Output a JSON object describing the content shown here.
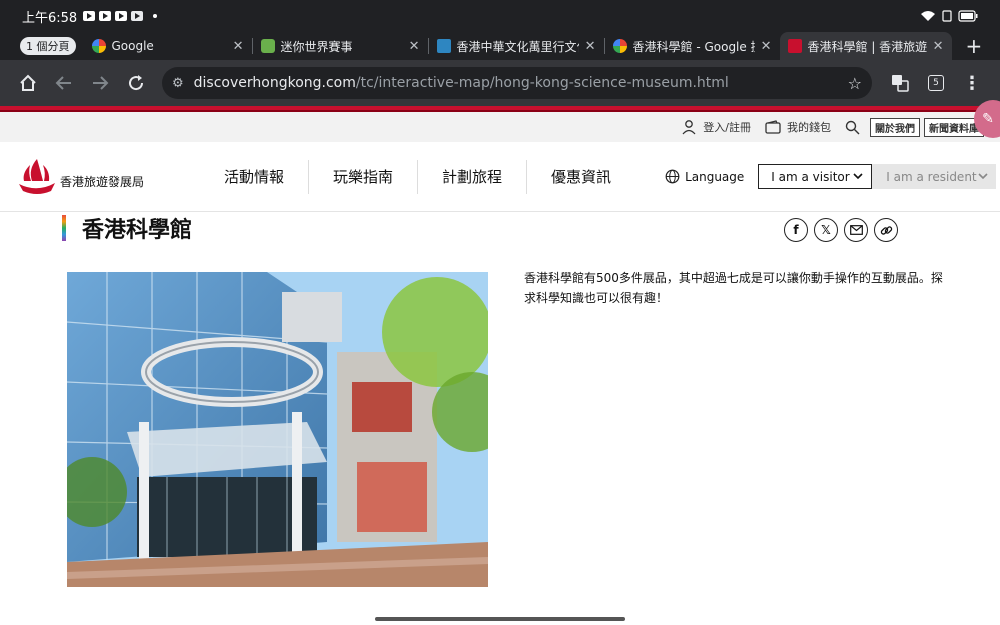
{
  "status_bar": {
    "time": "上午6:58"
  },
  "browser": {
    "tab_group_label": "1 個分頁",
    "tabs": [
      {
        "title": "Google"
      },
      {
        "title": "迷你世界賽事"
      },
      {
        "title": "香港中華文化萬里行文化影"
      },
      {
        "title": "香港科學館 - Google 搜尋"
      },
      {
        "title": "香港科學館 | 香港旅遊發展局"
      }
    ],
    "url_host": "discoverhongkong.com",
    "url_path": "/tc/interactive-map/hong-kong-science-museum.html",
    "tab_count": "5"
  },
  "utility": {
    "login": "登入/註冊",
    "wallet": "我的錢包",
    "about": "關於我們",
    "press": "新聞資料庫"
  },
  "header": {
    "logo_text": "香港旅遊發展局",
    "nav": [
      "活動情報",
      "玩樂指南",
      "計劃旅程",
      "優惠資訊"
    ],
    "language_label": "Language",
    "visitor_label": "I am a visitor",
    "resident_label": "I am a resident"
  },
  "content": {
    "title": "香港科學館",
    "description": "香港科學館有500多件展品，其中超過七成是可以讓你動手操作的互動展品。探求科學知識也可以很有趣！"
  },
  "colors": {
    "brand_red": "#c8102e",
    "browser_dark": "#202124",
    "toolbar": "#35363a"
  }
}
